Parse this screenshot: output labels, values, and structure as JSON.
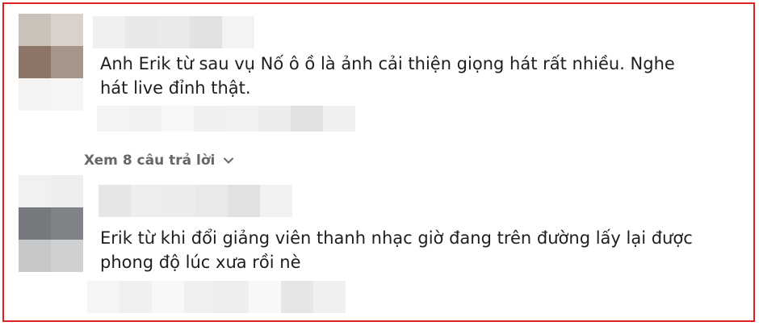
{
  "comments": [
    {
      "avatar_colors": [
        "#cac2b9",
        "#d8d2cb",
        "#8c7566",
        "#a5968c",
        "#f5f3f2",
        "#f6f5f4"
      ],
      "name_colors": [
        "#f0f0f0",
        "#e8e8e8",
        "#eaeaea",
        "#e2e2e2",
        "#f3f3f3"
      ],
      "text_line1": "Anh Erik từ sau vụ Nố ô ồ là ảnh cải thiện giọng hát rất nhiều. Nghe",
      "text_line2": "hát live đỉnh thật.",
      "action_colors": [
        "#f4f4f4",
        "#f1f1f1",
        "#f8f8f8",
        "#efefef",
        "#f2f2f2",
        "#ececec",
        "#e2e2e2",
        "#f0f0f0"
      ]
    },
    {
      "avatar_colors": [
        "#f1f1f1",
        "#eeeeee",
        "#75787c",
        "#7f8286",
        "#c6c7c9",
        "#cfd0d2"
      ],
      "name_colors": [
        "#e6e6e6",
        "#eeeeee",
        "#ececec",
        "#e9e9e9",
        "#e1e1e1",
        "#f2f2f2"
      ],
      "text_line1": "Erik từ khi đổi giảng viên thanh nhạc giờ đang trên đường lấy lại được",
      "text_line2": "phong độ lúc xưa rồi nè",
      "action_colors": [
        "#f5f5f5",
        "#f0f0f0",
        "#f7f7f7",
        "#efefef",
        "#eeeeee",
        "#f8f8f8",
        "#e6e6e6",
        "#f0f0f0"
      ]
    }
  ],
  "replies_link": {
    "label": "Xem 8 câu trả lời",
    "icon": "chevron-down-icon"
  },
  "accent_colors": {
    "border": "#e02020",
    "muted_text": "#65676b",
    "text": "#1c1e21"
  }
}
